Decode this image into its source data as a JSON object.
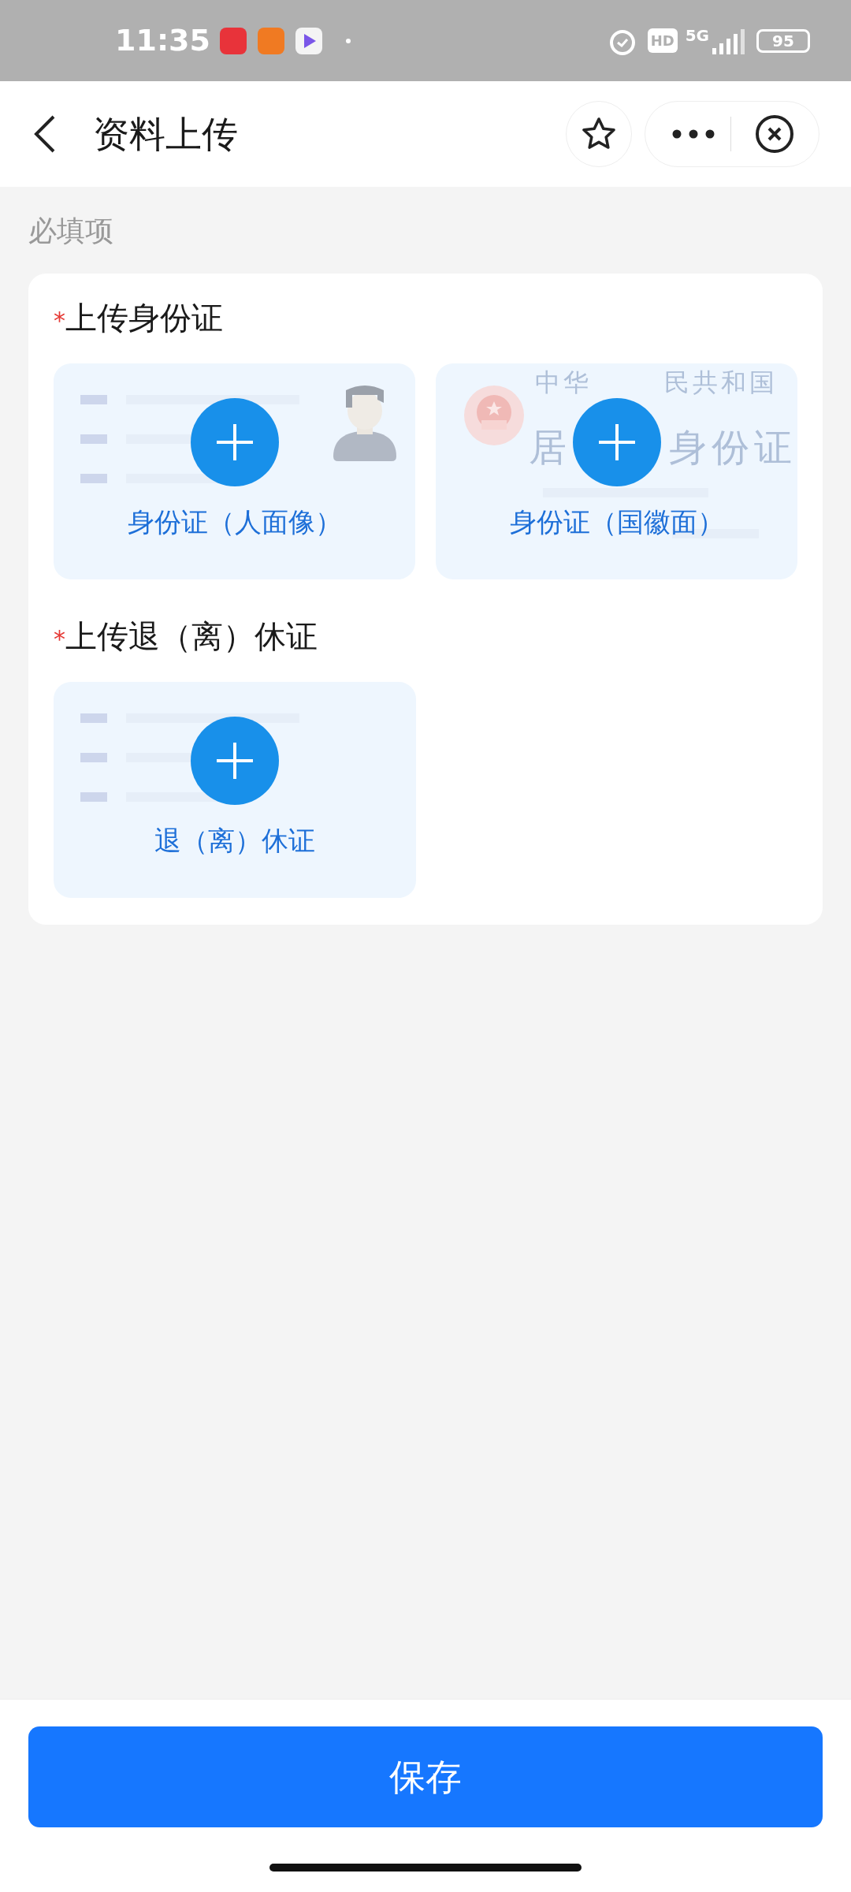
{
  "status_bar": {
    "time": "11:35",
    "hd": "HD",
    "network": "5G",
    "battery": "95"
  },
  "header": {
    "title": "资料上传"
  },
  "section_label": "必填项",
  "groups": [
    {
      "required_mark": "*",
      "title": "上传身份证",
      "uploads": [
        {
          "kind": "portrait",
          "label": "身份证（人面像）"
        },
        {
          "kind": "emblem",
          "label": "身份证（国徽面）",
          "card_text": [
            "中华",
            "民共和国",
            "居",
            "身份证"
          ]
        }
      ]
    },
    {
      "required_mark": "*",
      "title": "上传退（离）休证",
      "uploads": [
        {
          "kind": "lines",
          "label": "退（离）休证"
        }
      ]
    }
  ],
  "save_button": "保存"
}
